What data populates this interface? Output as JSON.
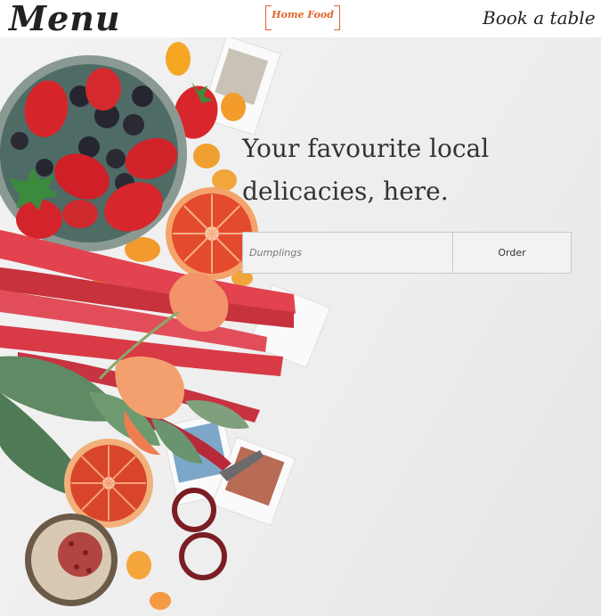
{
  "header": {
    "menu_label": "Menu",
    "logo_text": "Home Food",
    "book_label": "Book a table"
  },
  "hero": {
    "headline": "Your favourite local delicacies, here.",
    "search_placeholder": "Dumplings",
    "order_label": "Order"
  },
  "colors": {
    "accent": "#e0652b",
    "text": "#222222",
    "background": "#eeeeee"
  },
  "icons": [
    "home-food-logo"
  ]
}
